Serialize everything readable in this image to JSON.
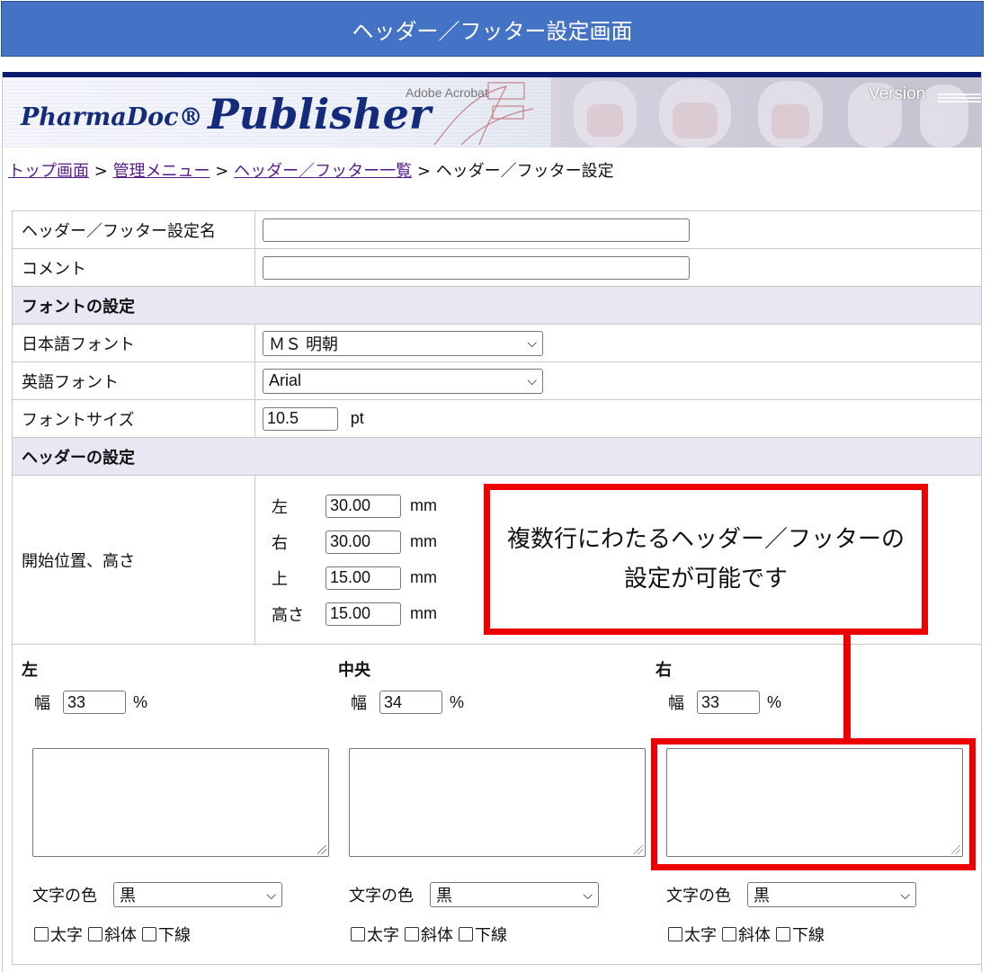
{
  "slide_title": "ヘッダー／フッター設定画面",
  "banner": {
    "logo_small": "PharmaDoc",
    "logo_reg": "®",
    "logo_large": "Publisher",
    "acrobat_text": "Adobe Acrobat",
    "version_label": "Version"
  },
  "breadcrumb": {
    "links": [
      "トップ画面",
      "管理メニュー",
      "ヘッダー／フッター一覧"
    ],
    "separator": ">",
    "current": "ヘッダー／フッター設定"
  },
  "form": {
    "name_label": "ヘッダー／フッター設定名",
    "name_value": "",
    "comment_label": "コメント",
    "comment_value": "",
    "font_section": "フォントの設定",
    "jp_font_label": "日本語フォント",
    "jp_font_value": "ＭＳ 明朝",
    "en_font_label": "英語フォント",
    "en_font_value": "Arial",
    "font_size_label": "フォントサイズ",
    "font_size_value": "10.5",
    "font_size_unit": "pt",
    "header_section": "ヘッダーの設定",
    "position_label": "開始位置、高さ",
    "position_rows": [
      {
        "label": "左",
        "value": "30.00",
        "unit": "mm"
      },
      {
        "label": "右",
        "value": "30.00",
        "unit": "mm"
      },
      {
        "label": "上",
        "value": "15.00",
        "unit": "mm"
      },
      {
        "label": "高さ",
        "value": "15.00",
        "unit": "mm"
      }
    ],
    "columns": [
      {
        "heading": "左",
        "width_label": "幅",
        "width_value": "33",
        "width_unit": "%",
        "text": "",
        "color_label": "文字の色",
        "color_value": "黒",
        "bold": "太字",
        "italic": "斜体",
        "underline": "下線"
      },
      {
        "heading": "中央",
        "width_label": "幅",
        "width_value": "34",
        "width_unit": "%",
        "text": "",
        "color_label": "文字の色",
        "color_value": "黒",
        "bold": "太字",
        "italic": "斜体",
        "underline": "下線"
      },
      {
        "heading": "右",
        "width_label": "幅",
        "width_value": "33",
        "width_unit": "%",
        "text": "",
        "color_label": "文字の色",
        "color_value": "黒",
        "bold": "太字",
        "italic": "斜体",
        "underline": "下線"
      }
    ]
  },
  "callout": {
    "line1": "複数行にわたるヘッダー／フッターの",
    "line2": "設定が可能です"
  },
  "colors": {
    "title_bar": "#4472c4",
    "section_bg": "#e8e8f4",
    "callout_border": "#ee0000",
    "banner_top": "#0b1a6e",
    "link": "#551a8b"
  }
}
